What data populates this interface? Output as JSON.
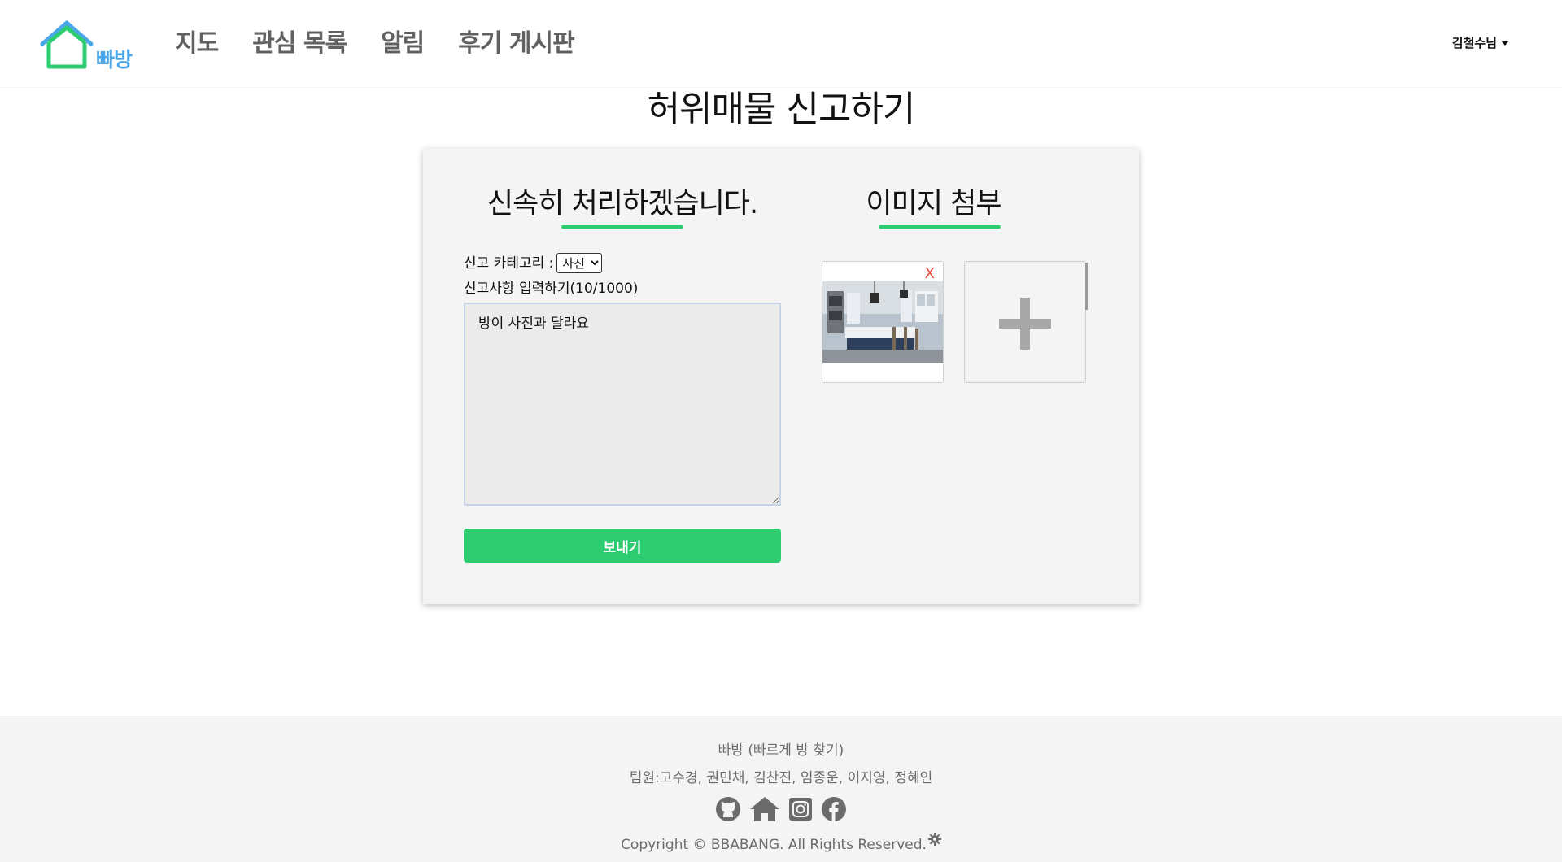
{
  "header": {
    "logo_text": "빠방",
    "nav": [
      "지도",
      "관심 목록",
      "알림",
      "후기 게시판"
    ],
    "user_label": "김철수님"
  },
  "page_title": "허위매물 신고하기",
  "form": {
    "heading_left": "신속히 처리하겠습니다.",
    "heading_right": "이미지 첨부",
    "category_label": "신고 카테고리 :",
    "category_selected": "사진",
    "input_label": "신고사항 입력하기(10/1000)",
    "textarea_value": "방이 사진과 달라요",
    "send_label": "보내기",
    "remove_label": "X"
  },
  "footer": {
    "name": "빠방 (빠르게 방 찾기)",
    "team": "팀원:고수경, 권민채, 김찬진, 임종운, 이지영, 정혜인",
    "icons": [
      "github-icon",
      "home-icon",
      "instagram-icon",
      "facebook-icon"
    ],
    "copyright": "Copyright © BBABANG. All Rights Reserved."
  },
  "colors": {
    "accent": "#2ecc71",
    "logo_blue": "#4aa8ea",
    "nav_text": "#616161",
    "remove": "#e74c3c"
  }
}
